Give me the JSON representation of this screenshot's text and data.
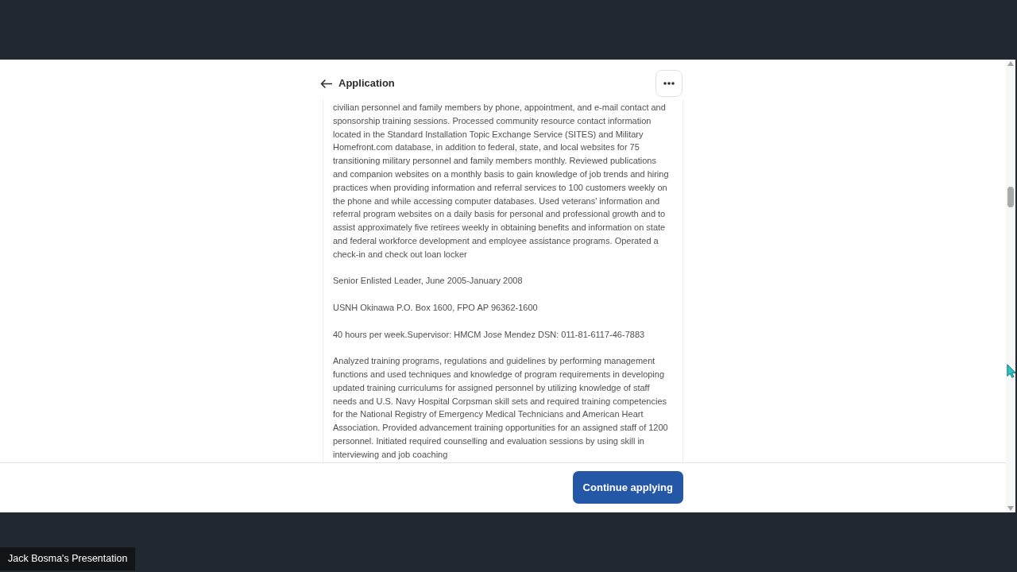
{
  "app": {
    "header": {
      "title": "Application"
    },
    "content": {
      "paragraphs": [
        "civilian personnel and family members by phone, appointment, and e-mail contact and sponsorship training sessions. Processed community resource contact information located in the Standard Installation Topic Exchange Service (SITES) and Military Homefront.com database, in addition to federal, state, and local websites for 75 transitioning military personnel and family members monthly. Reviewed publications and companion websites on a monthly basis to gain knowledge of job trends and hiring practices when providing information and referral services to 100 customers weekly on the phone and while accessing computer databases. Used veterans' information and referral program websites on a daily basis for personal and professional growth and to assist approximately five retirees weekly in obtaining benefits and information on state and federal workforce development and employee assistance programs. Operated a check-in and check out loan locker",
        "Senior Enlisted Leader, June 2005-January 2008",
        "USNH Okinawa P.O. Box 1600, FPO AP 96362-1600",
        "40 hours per week.Supervisor: HMCM Jose Mendez DSN: 011-81-6117-46-7883",
        "Analyzed training programs, regulations and guidelines by performing management functions and used techniques and knowledge of program requirements in developing updated training curriculums for assigned personnel by utilizing knowledge of staff needs and U.S. Navy Hospital Corpsman skill sets and required training competencies for the National Registry of Emergency Medical Technicians and American Heart Association. Provided advancement training opportunities for an assigned staff of 1200 personnel. Initiated required counselling and evaluation sessions by using skill in interviewing and job coaching"
      ]
    },
    "footer": {
      "primary_button": "Continue applying"
    }
  },
  "presenter_label": "Jack Bosma's Presentation"
}
